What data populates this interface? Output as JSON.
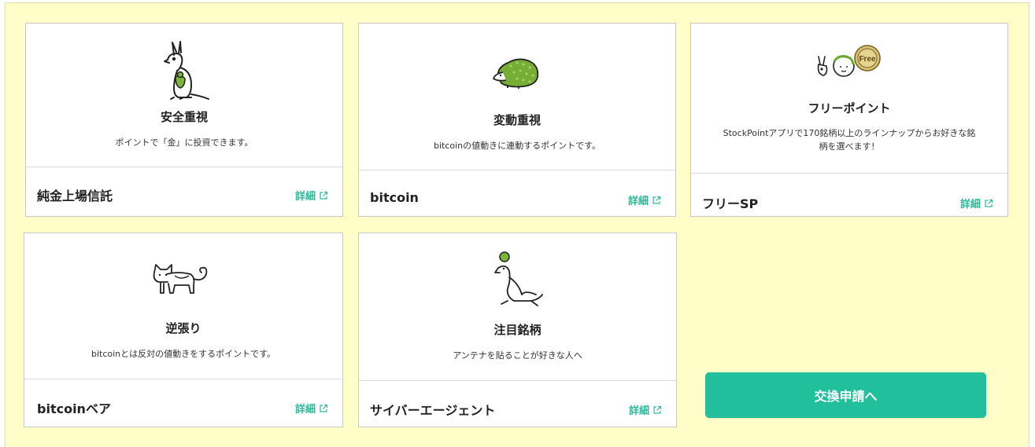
{
  "cards": [
    {
      "title": "安全重視",
      "description": "ポイントで「金」に投資できます。",
      "name": "純金上場信託",
      "detail_label": "詳細",
      "illustration": "kangaroo-icon"
    },
    {
      "title": "変動重視",
      "description": "bitcoinの値動きに連動するポイントです。",
      "name": "bitcoin",
      "detail_label": "詳細",
      "illustration": "hedgehog-icon"
    },
    {
      "title": "フリーポイント",
      "description": "StockPointアプリで170銘柄以上のラインナップからお好きな銘柄を選べます！",
      "name": "フリーSP",
      "detail_label": "詳細",
      "illustration": "free-coin-icon",
      "badge_text": "Free"
    },
    {
      "title": "逆張り",
      "description": "bitcoinとは反対の値動きをするポイントです。",
      "name": "bitcoinベア",
      "detail_label": "詳細",
      "illustration": "cat-icon"
    },
    {
      "title": "注目銘柄",
      "description": "アンテナを貼ることが好きな人へ",
      "name": "サイバーエージェント",
      "detail_label": "詳細",
      "illustration": "seal-icon"
    }
  ],
  "cta": {
    "label": "交換申請へ"
  },
  "colors": {
    "background": "#fffdc8",
    "accent": "#22bf9c",
    "detail_link": "#2db99a"
  }
}
